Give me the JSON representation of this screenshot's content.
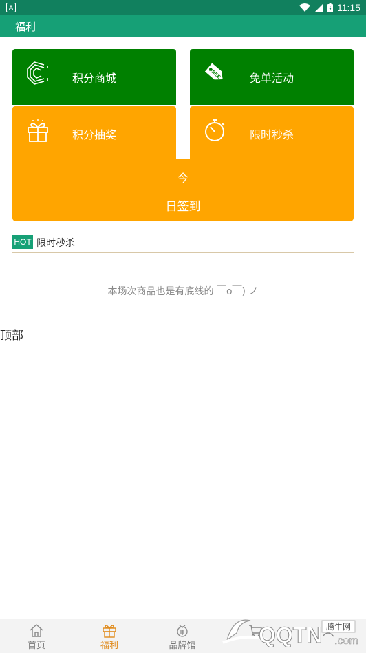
{
  "status_bar": {
    "app_badge": "A",
    "time": "11:15"
  },
  "app_bar": {
    "title": "福利"
  },
  "tiles": {
    "mall": {
      "label": "积分商城",
      "icon": "c-coin-icon"
    },
    "free": {
      "label": "免单活动",
      "icon": "free-tag-icon",
      "icon_text": "FREE"
    },
    "lottery": {
      "label": "积分抽奖",
      "icon": "gift-box-icon"
    },
    "flash": {
      "label": "限时秒杀",
      "icon": "stopwatch-icon"
    },
    "checkin": {
      "line1": "今",
      "line2": "日签到"
    }
  },
  "hot_section": {
    "badge": "HOT",
    "title": "限时秒杀"
  },
  "empty_note": "本场次商品也是有底线的 ￣o￣) ノ",
  "top_label": "顶部",
  "tab_bar": {
    "tabs": [
      {
        "label": "首页",
        "icon": "home-icon",
        "active": false
      },
      {
        "label": "福利",
        "icon": "gift-icon",
        "active": true
      },
      {
        "label": "品牌馆",
        "icon": "brand-medal-icon",
        "active": false
      },
      {
        "label": "",
        "icon": "cart-icon",
        "active": false
      },
      {
        "label": "",
        "icon": "user-icon",
        "active": false
      }
    ]
  },
  "watermark": {
    "brand": "QQTN",
    "suffix": ".com",
    "tag": "腾牛网"
  },
  "colors": {
    "status_bar": "#11805e",
    "app_bar": "#16a076",
    "tile_green": "#008000",
    "tile_orange": "#ffa500",
    "tab_active": "#e08a1a"
  }
}
